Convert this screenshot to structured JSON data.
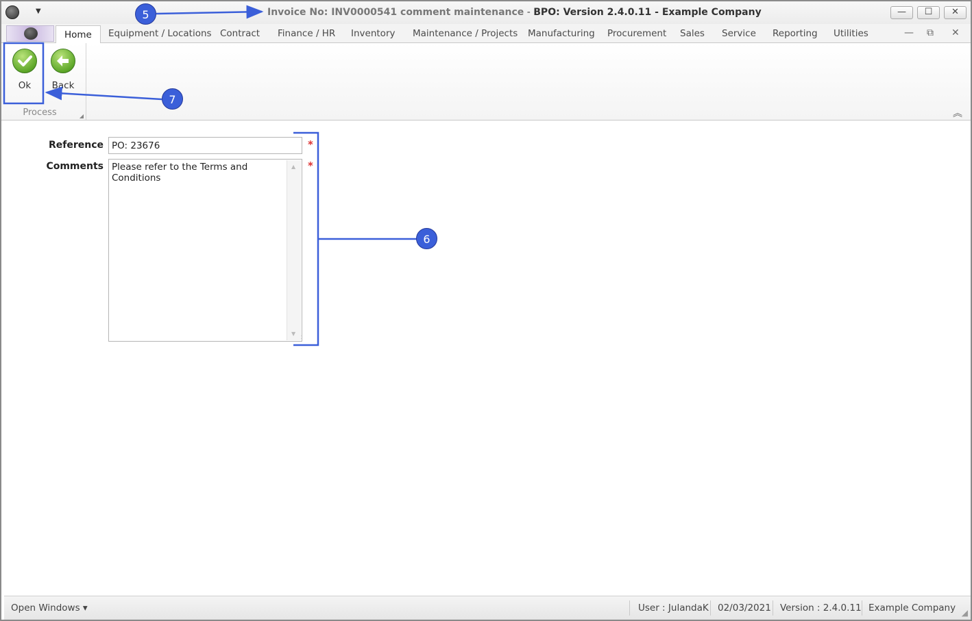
{
  "window": {
    "title_doc": "Invoice No: INV0000541 comment maintenance",
    "title_sep": " - ",
    "title_app": "BPO: Version 2.4.0.11 - Example Company",
    "minimize": "—",
    "maximize": "☐",
    "close": "✕"
  },
  "tabs": [
    {
      "label": "Home"
    },
    {
      "label": "Equipment / Locations"
    },
    {
      "label": "Contract"
    },
    {
      "label": "Finance / HR"
    },
    {
      "label": "Inventory"
    },
    {
      "label": "Maintenance / Projects"
    },
    {
      "label": "Manufacturing"
    },
    {
      "label": "Procurement"
    },
    {
      "label": "Sales"
    },
    {
      "label": "Service"
    },
    {
      "label": "Reporting"
    },
    {
      "label": "Utilities"
    }
  ],
  "mdi": {
    "minimize": "—",
    "restore": "⧉",
    "close": "✕"
  },
  "ribbon": {
    "ok_label": "Ok",
    "back_label": "Back",
    "group_label": "Process"
  },
  "form": {
    "reference_label": "Reference",
    "reference_value": "PO: 23676",
    "comments_label": "Comments",
    "comments_value": "Please refer to the Terms and Conditions",
    "required_mark": "*"
  },
  "statusbar": {
    "open_windows": "Open Windows ▾",
    "user": "User : JulandaK",
    "date": "02/03/2021",
    "version": "Version : 2.4.0.11",
    "company": "Example Company"
  },
  "annotations": {
    "c5": "5",
    "c6": "6",
    "c7": "7",
    "color": "#3b5fd9"
  },
  "icons": [
    "app-logo-icon",
    "quick-access-dropdown-icon",
    "check-icon",
    "back-arrow-icon",
    "collapse-ribbon-icon",
    "resize-grip-icon"
  ]
}
